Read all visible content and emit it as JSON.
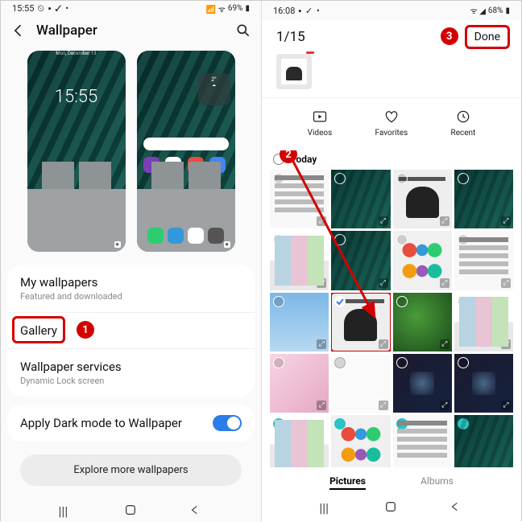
{
  "left": {
    "status": {
      "time": "15:55",
      "battery": "69%",
      "icons": "⏰ ⬛ ✓ ⋯"
    },
    "header": {
      "title": "Wallpaper"
    },
    "preview": {
      "clock": "15:55",
      "date": "Mon, December 13",
      "weather": "2°"
    },
    "list": {
      "my_wallpapers": {
        "label": "My wallpapers",
        "sub": "Featured and downloaded"
      },
      "gallery": {
        "label": "Gallery"
      },
      "services": {
        "label": "Wallpaper services",
        "sub": "Dynamic Lock screen"
      },
      "dark_mode": {
        "label": "Apply Dark mode to Wallpaper"
      }
    },
    "explore": "Explore more wallpapers"
  },
  "right": {
    "status": {
      "time": "16:08",
      "battery": "68%",
      "icons": "⬛ ✓ ⋯"
    },
    "count": "1/15",
    "done": "Done",
    "categories": {
      "videos": "Videos",
      "favorites": "Favorites",
      "recent": "Recent"
    },
    "section": "Today",
    "tabs": {
      "pictures": "Pictures",
      "albums": "Albums"
    }
  },
  "annotations": {
    "one": "1",
    "two": "2",
    "three": "3"
  }
}
